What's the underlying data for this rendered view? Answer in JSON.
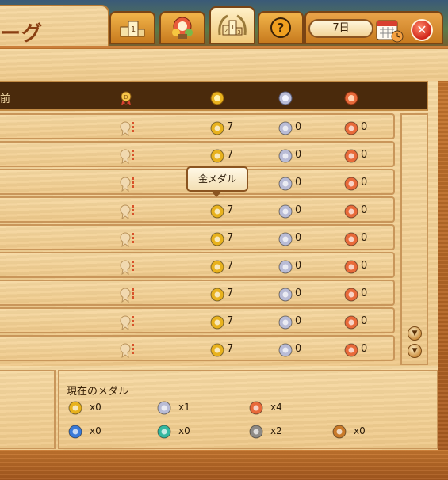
{
  "header": {
    "title": "ーグ",
    "day_label": "7日"
  },
  "tabs": [
    {
      "name": "tab-podium-1",
      "icon": "podium-icon"
    },
    {
      "name": "tab-flower-wreath",
      "icon": "flower-wreath-icon"
    },
    {
      "name": "tab-ranking-podium",
      "icon": "laurel-podium-icon",
      "active": true
    },
    {
      "name": "tab-help",
      "icon": "question-icon"
    }
  ],
  "table": {
    "header_label_partial": "前",
    "columns": [
      "rank-ribbon-icon",
      "gold-medal-icon",
      "silver-medal-icon",
      "bronze-medal-icon"
    ],
    "rows": [
      {
        "gold": "7",
        "silver": "0",
        "bronze": "0"
      },
      {
        "gold": "7",
        "silver": "0",
        "bronze": "0"
      },
      {
        "gold": "7",
        "silver": "0",
        "bronze": "0"
      },
      {
        "gold": "7",
        "silver": "0",
        "bronze": "0"
      },
      {
        "gold": "7",
        "silver": "0",
        "bronze": "0"
      },
      {
        "gold": "7",
        "silver": "0",
        "bronze": "0"
      },
      {
        "gold": "7",
        "silver": "0",
        "bronze": "0"
      },
      {
        "gold": "7",
        "silver": "0",
        "bronze": "0"
      },
      {
        "gold": "7",
        "silver": "0",
        "bronze": "0"
      }
    ]
  },
  "tooltip": {
    "text": "金メダル"
  },
  "current_medals": {
    "title": "現在のメダル",
    "items": [
      {
        "name": "gold",
        "count": "x0",
        "color": "#e8b21e"
      },
      {
        "name": "silver",
        "count": "x1",
        "color": "#b9bcd6"
      },
      {
        "name": "bronze",
        "count": "x4",
        "color": "#e86a3a"
      },
      {
        "name": "blue",
        "count": "x0",
        "color": "#3a7ad8"
      },
      {
        "name": "teal",
        "count": "x0",
        "color": "#33b8a0"
      },
      {
        "name": "grey",
        "count": "x2",
        "color": "#8d8a86"
      },
      {
        "name": "copper",
        "count": "x0",
        "color": "#c97a2a"
      }
    ]
  },
  "colors": {
    "gold": "#e8b21e",
    "silver": "#b9bcd6",
    "bronze": "#e86a3a",
    "header_bg": "#4a2a0c"
  }
}
